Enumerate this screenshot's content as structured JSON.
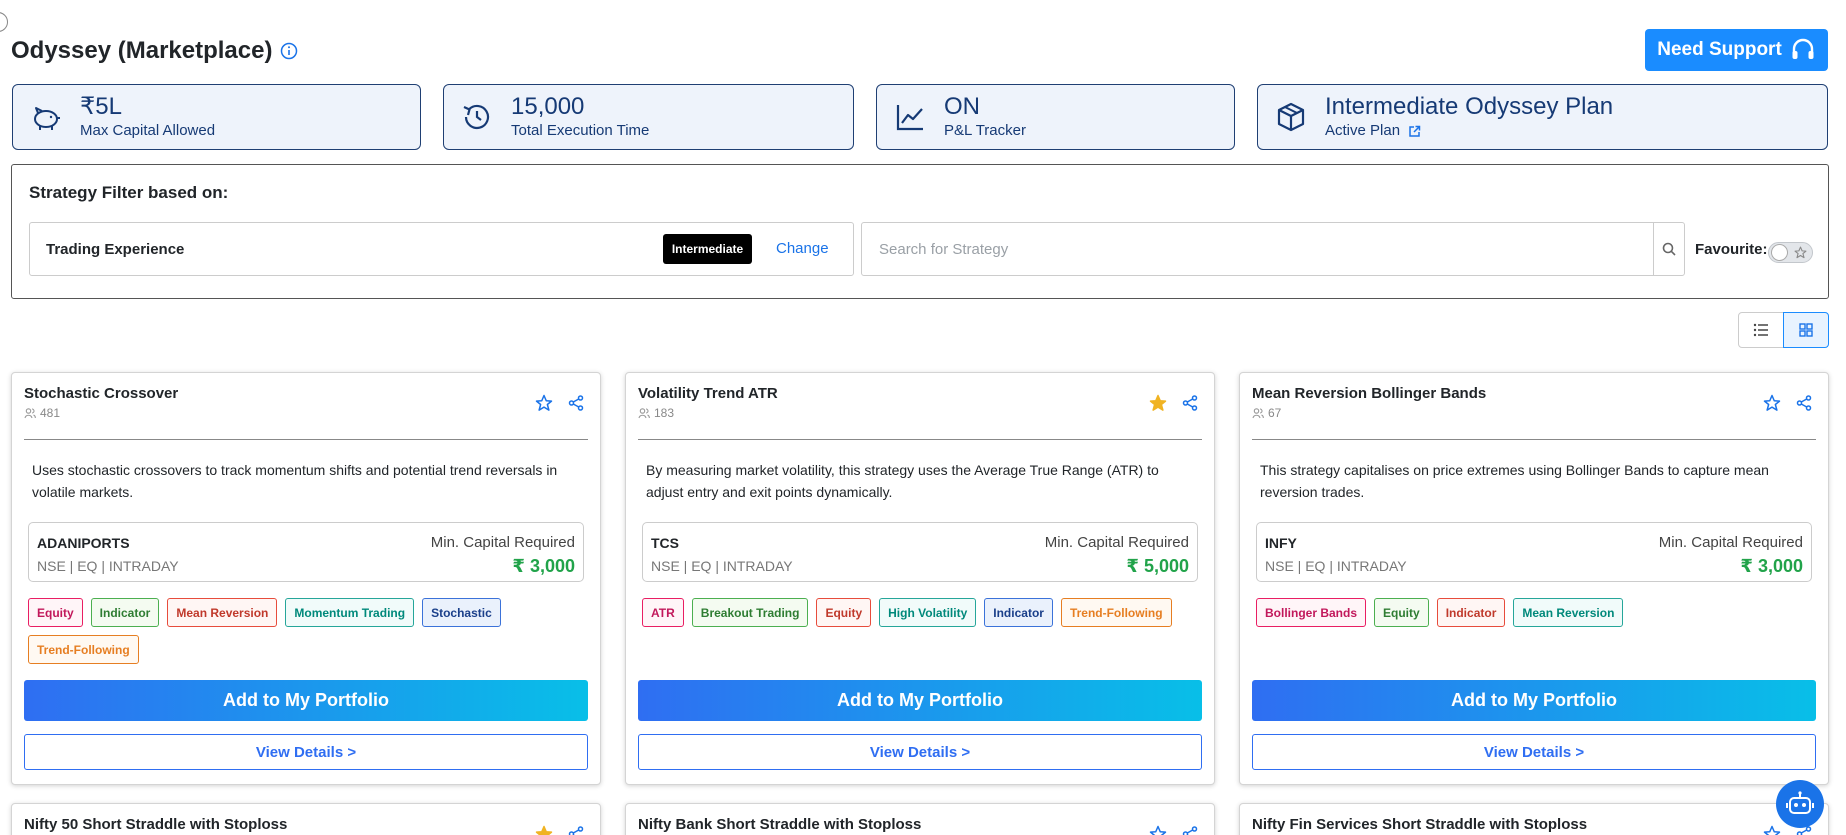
{
  "page": {
    "title": "Odyssey (Marketplace)",
    "support_label": "Need Support"
  },
  "stats": [
    {
      "value": "₹5L",
      "label": "Max Capital Allowed",
      "icon": "piggy-bank-icon"
    },
    {
      "value": "15,000",
      "label": "Total Execution Time",
      "icon": "history-icon"
    },
    {
      "value": "ON",
      "label": "P&L Tracker",
      "icon": "line-chart-icon"
    },
    {
      "value": "Intermediate Odyssey Plan",
      "label": "Active Plan",
      "icon": "package-icon"
    }
  ],
  "filter": {
    "title": "Strategy Filter based on:",
    "experience_label": "Trading Experience",
    "experience_value": "Intermediate",
    "change_label": "Change",
    "search_placeholder": "Search for Strategy",
    "favourite_label": "Favourite:"
  },
  "cards": [
    {
      "name": "Stochastic Crossover",
      "users": "481",
      "favourite": false,
      "description": "Uses stochastic crossovers to track momentum shifts and potential trend reversals in volatile markets.",
      "symbol": "ADANIPORTS",
      "exchange": "NSE | EQ | INTRADAY",
      "min_capital_label": "Min. Capital Required",
      "min_capital": "₹ 3,000",
      "tags": [
        {
          "label": "Equity",
          "color": "pink"
        },
        {
          "label": "Indicator",
          "color": "green"
        },
        {
          "label": "Mean Reversion",
          "color": "red"
        },
        {
          "label": "Momentum Trading",
          "color": "teal"
        },
        {
          "label": "Stochastic",
          "color": "blue"
        },
        {
          "label": "Trend-Following",
          "color": "orange"
        }
      ],
      "add_label": "Add to My Portfolio",
      "details_label": "View Details >"
    },
    {
      "name": "Volatility Trend ATR",
      "users": "183",
      "favourite": true,
      "description": "By measuring market volatility, this strategy uses the Average True Range (ATR) to adjust entry and exit points dynamically.",
      "symbol": "TCS",
      "exchange": "NSE | EQ | INTRADAY",
      "min_capital_label": "Min. Capital Required",
      "min_capital": "₹ 5,000",
      "tags": [
        {
          "label": "ATR",
          "color": "pink"
        },
        {
          "label": "Breakout Trading",
          "color": "green"
        },
        {
          "label": "Equity",
          "color": "red"
        },
        {
          "label": "High Volatility",
          "color": "teal"
        },
        {
          "label": "Indicator",
          "color": "blue"
        },
        {
          "label": "Trend-Following",
          "color": "orange"
        }
      ],
      "add_label": "Add to My Portfolio",
      "details_label": "View Details >"
    },
    {
      "name": "Mean Reversion Bollinger Bands",
      "users": "67",
      "favourite": false,
      "description": "This strategy capitalises on price extremes using Bollinger Bands to capture mean reversion trades.",
      "symbol": "INFY",
      "exchange": "NSE | EQ | INTRADAY",
      "min_capital_label": "Min. Capital Required",
      "min_capital": "₹ 3,000",
      "tags": [
        {
          "label": "Bollinger Bands",
          "color": "pink"
        },
        {
          "label": "Equity",
          "color": "green"
        },
        {
          "label": "Indicator",
          "color": "red"
        },
        {
          "label": "Mean Reversion",
          "color": "teal"
        }
      ],
      "add_label": "Add to My Portfolio",
      "details_label": "View Details >"
    }
  ],
  "next_cards": [
    {
      "name": "Nifty 50 Short Straddle with Stoploss",
      "favourite": true
    },
    {
      "name": "Nifty Bank Short Straddle with Stoploss",
      "favourite": false
    },
    {
      "name": "Nifty Fin Services Short Straddle with Stoploss",
      "favourite": false
    }
  ],
  "colors": {
    "accent": "#1a8cff",
    "navy": "#163a75",
    "success": "#21a34a",
    "star": "#f0b323"
  }
}
